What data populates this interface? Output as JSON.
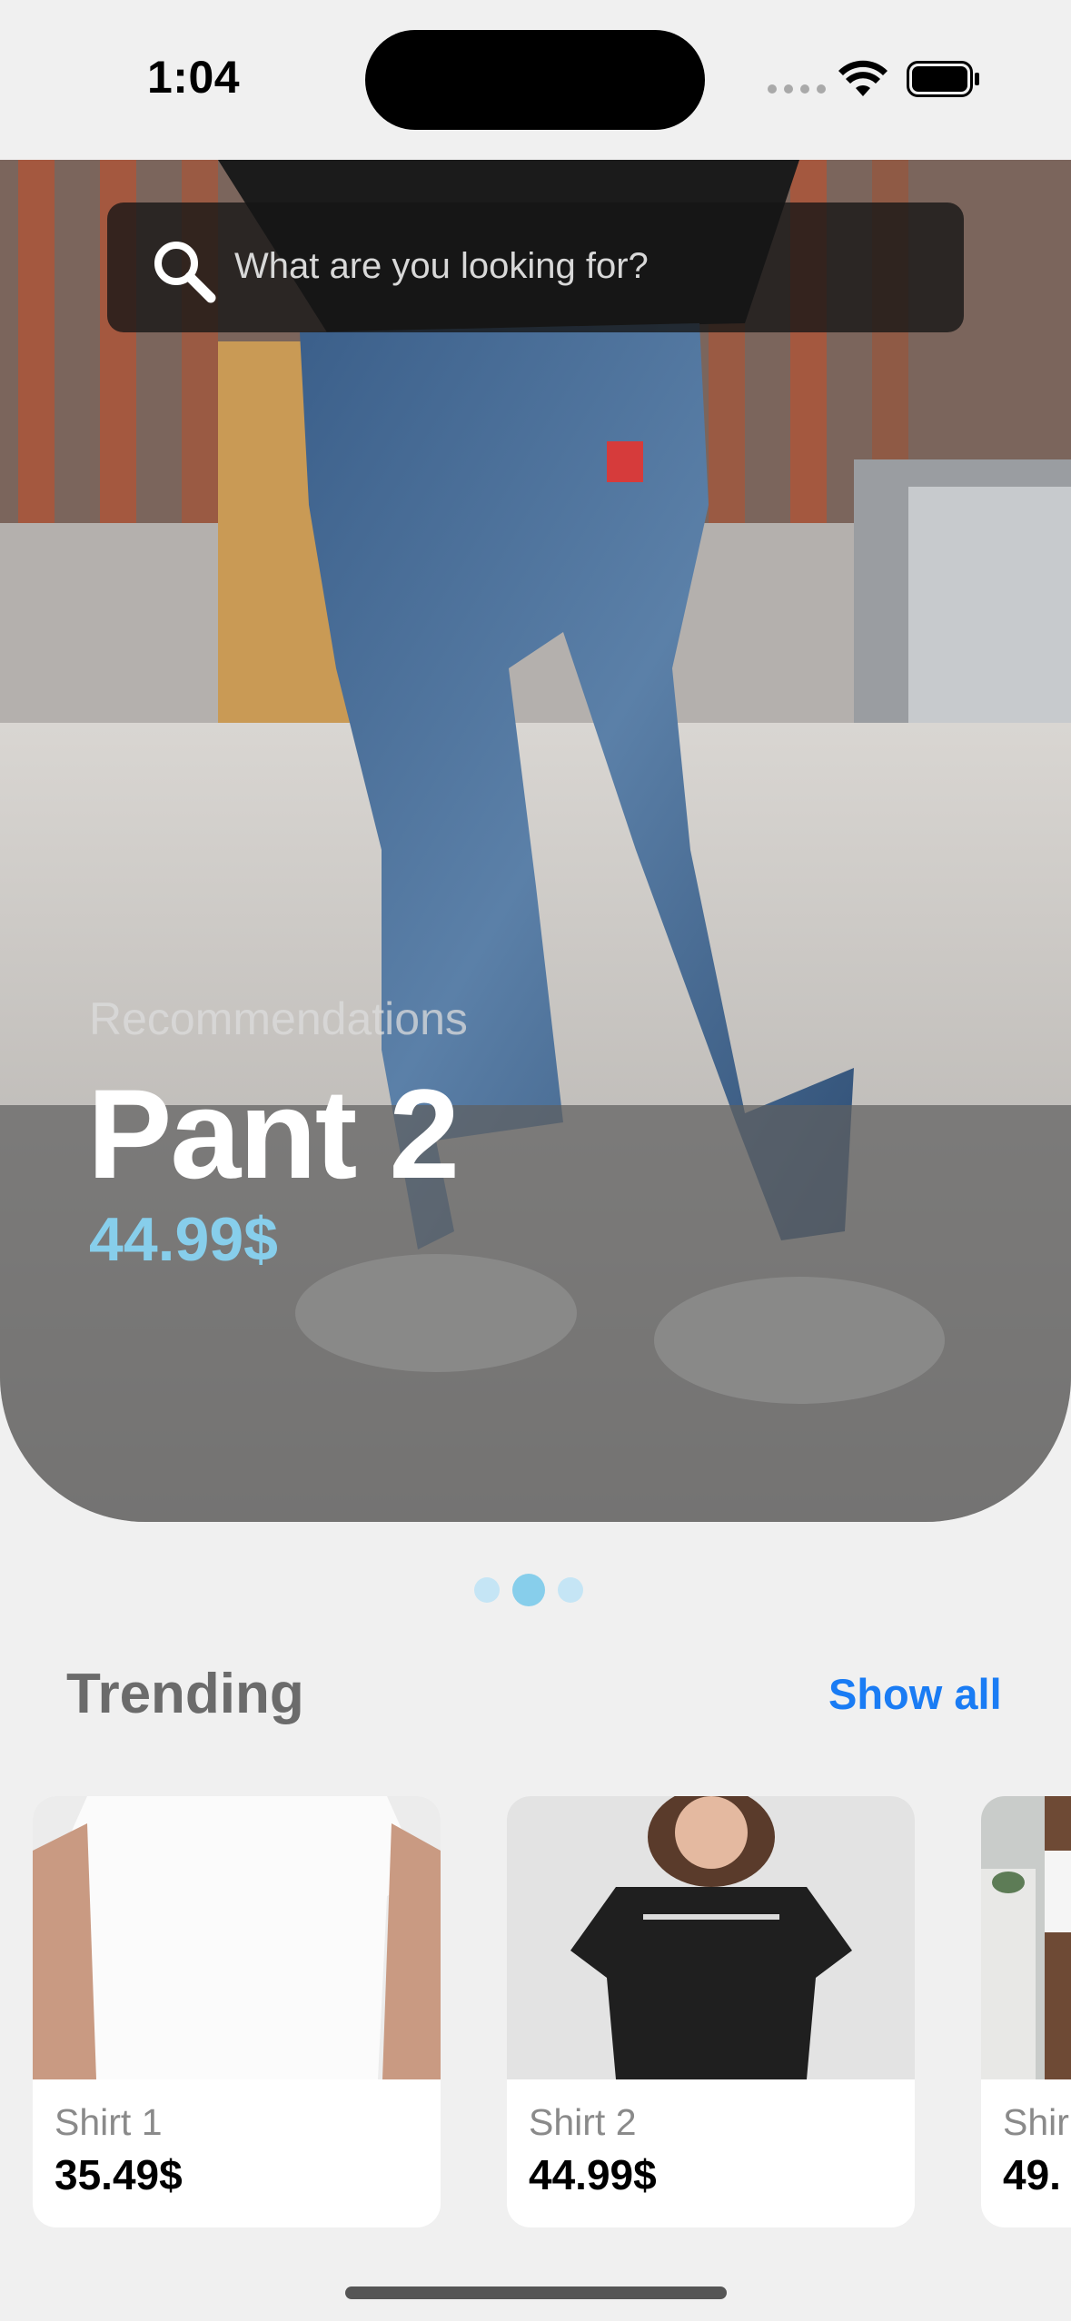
{
  "status_bar": {
    "time": "1:04"
  },
  "search": {
    "placeholder": "What are you looking for?"
  },
  "hero": {
    "label": "Recommendations",
    "title": "Pant 2",
    "price": "44.99$",
    "page_indicator": {
      "count": 3,
      "active_index": 1
    }
  },
  "trending": {
    "title": "Trending",
    "show_all": "Show all",
    "items": [
      {
        "name": "Shirt 1",
        "price": "35.49$"
      },
      {
        "name": "Shirt 2",
        "price": "44.99$"
      },
      {
        "name": "Shir",
        "price": "49."
      }
    ]
  },
  "colors": {
    "accent_blue": "#1a7cf4",
    "price_blue": "#87ceeb",
    "background": "#f0f0f0"
  }
}
